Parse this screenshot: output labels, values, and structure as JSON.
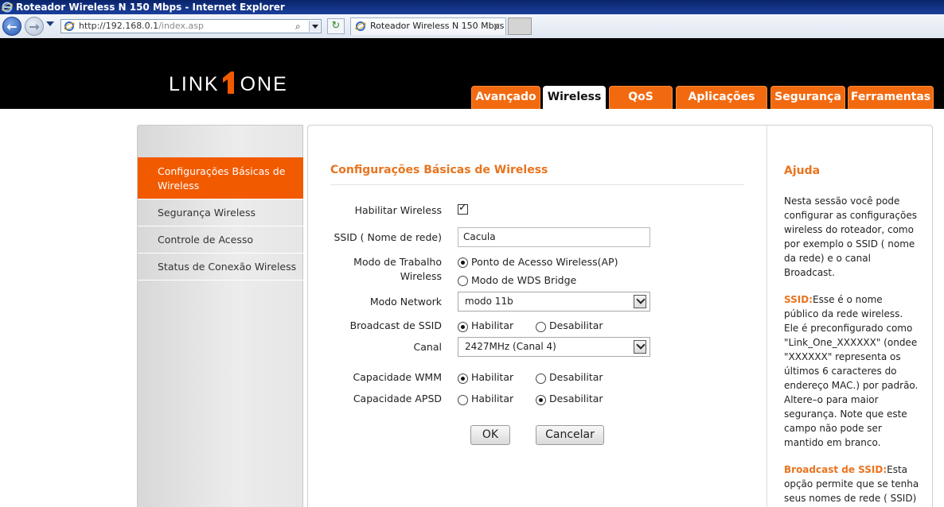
{
  "browser": {
    "window_title": "Roteador Wireless N 150 Mbps - Internet Explorer",
    "url_host": "http://192.168.0.1",
    "url_path": "/index.asp",
    "tab_title": "Roteador Wireless N 150 Mbps",
    "tab_close": "×",
    "refresh_glyph": "↻",
    "search_glyph": "⌕",
    "back_glyph": "←",
    "forward_glyph": "→"
  },
  "header": {
    "logo_left": "LINK",
    "logo_right": "ONE",
    "logo_mark_color": "#f25a00",
    "tabs": [
      {
        "label": "Avançado"
      },
      {
        "label": "Wireless",
        "active": true
      },
      {
        "label": "QoS"
      },
      {
        "label": "Aplicações"
      },
      {
        "label": "Segurança"
      },
      {
        "label": "Ferramentas"
      }
    ]
  },
  "sidebar": {
    "items": [
      {
        "label": "Configurações Básicas de Wireless",
        "active": true
      },
      {
        "label": "Segurança Wireless"
      },
      {
        "label": "Controle de Acesso"
      },
      {
        "label": "Status de Conexão Wireless"
      }
    ]
  },
  "form": {
    "title": "Configurações Básicas de Wireless",
    "enable_wireless_label": "Habilitar Wireless",
    "enable_wireless_checked": true,
    "ssid_label": "SSID ( Nome de rede)",
    "ssid_value": "Cacula",
    "work_mode_label_1": "Modo de Trabalho",
    "work_mode_label_2": "Wireless",
    "work_mode_ap": "Ponto de Acesso Wireless(AP)",
    "work_mode_wds": "Modo de WDS Bridge",
    "work_mode_selected": "ap",
    "network_mode_label": "Modo Network",
    "network_mode_value": "modo 11b",
    "broadcast_label": "Broadcast de SSID",
    "broadcast_enable": "Habilitar",
    "broadcast_disable": "Desabilitar",
    "broadcast_selected": "enable",
    "channel_label": "Canal",
    "channel_value": "2427MHz (Canal 4)",
    "wmm_label": "Capacidade WMM",
    "wmm_enable": "Habilitar",
    "wmm_disable": "Desabilitar",
    "wmm_selected": "enable",
    "apsd_label": "Capacidade APSD",
    "apsd_enable": "Habilitar",
    "apsd_disable": "Desabilitar",
    "apsd_selected": "disable",
    "ok_label": "OK",
    "cancel_label": "Cancelar"
  },
  "help": {
    "title": "Ajuda",
    "p1": "Nesta sessão você pode configurar as configurações wireless do roteador, como por exemplo o SSID ( nome da rede) e o canal Broadcast.",
    "p2_term": "SSID:",
    "p2": "Esse é o nome público da rede wireless. Ele é preconfigurado como \"Link_One_XXXXXX\" (ondee \"XXXXXX\" representa os últimos 6 caracteres do endereço MAC.) por padrão. Altere–o para maior segurança. Note que este campo não pode ser mantido em branco.",
    "p3_term": "Broadcast de SSID:",
    "p3": "Esta opção permite que se tenha seus nomes de rede ( SSID)"
  }
}
